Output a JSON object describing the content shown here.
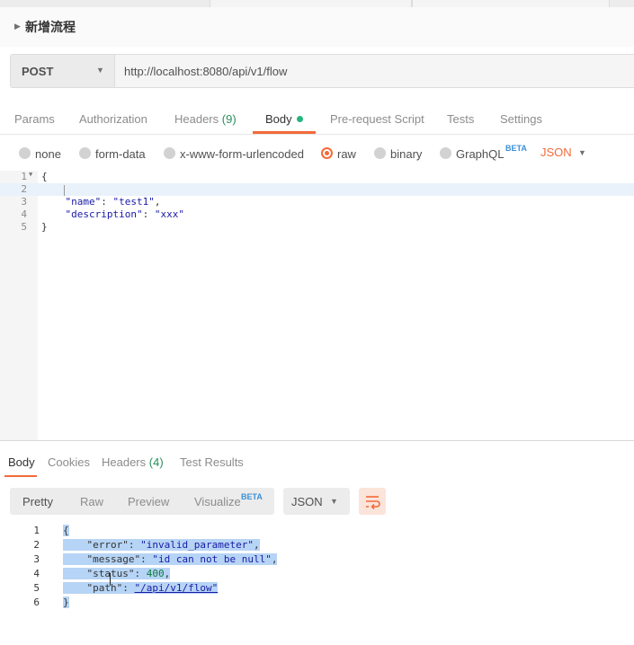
{
  "request": {
    "name": "新增流程",
    "method": "POST",
    "url": "http://localhost:8080/api/v1/flow",
    "tabs": {
      "params": "Params",
      "authorization": "Authorization",
      "headers": "Headers",
      "headers_count": "(9)",
      "body": "Body",
      "prerequest": "Pre-request Script",
      "tests": "Tests",
      "settings": "Settings"
    },
    "body_types": {
      "none": "none",
      "form_data": "form-data",
      "urlencoded": "x-www-form-urlencoded",
      "raw": "raw",
      "binary": "binary",
      "graphql": "GraphQL",
      "graphql_badge": "BETA",
      "selected": "raw"
    },
    "format": "JSON",
    "editor": {
      "line_numbers": [
        "1",
        "2",
        "3",
        "4",
        "5"
      ],
      "line1": "{",
      "line3_key": "\"name\"",
      "line3_val": "\"test1\"",
      "line4_key": "\"description\"",
      "line4_val": "\"xxx\"",
      "line5": "}"
    }
  },
  "response": {
    "tabs": {
      "body": "Body",
      "cookies": "Cookies",
      "headers": "Headers",
      "headers_count": "(4)",
      "test_results": "Test Results"
    },
    "view_modes": {
      "pretty": "Pretty",
      "raw": "Raw",
      "preview": "Preview",
      "visualize": "Visualize",
      "visualize_badge": "BETA"
    },
    "format": "JSON",
    "line_numbers": [
      "1",
      "2",
      "3",
      "4",
      "5",
      "6"
    ],
    "open_brace": "{",
    "close_brace": "}",
    "fields": {
      "error_key": "\"error\"",
      "error_val": "\"invalid_parameter\"",
      "message_key": "\"message\"",
      "message_val": "\"id can not be null\"",
      "status_key": "\"status\"",
      "status_val": "400",
      "path_key": "\"path\"",
      "path_val": "\"/api/v1/flow\""
    }
  },
  "colors": {
    "accent": "#f26b3a",
    "count_green": "#2a8f5c",
    "string_blue": "#1a1aa6",
    "selection": "#b6d4f5"
  }
}
